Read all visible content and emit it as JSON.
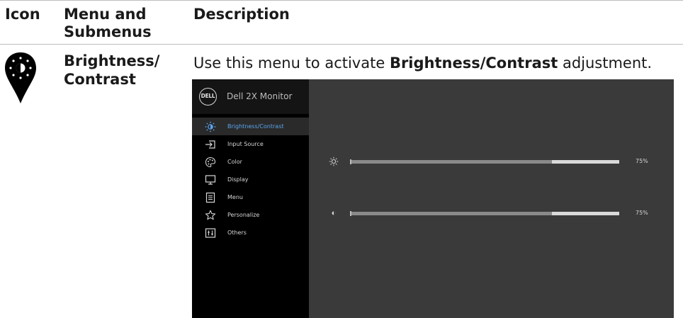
{
  "table": {
    "headers": {
      "icon": "Icon",
      "menu_line1": "Menu and",
      "menu_line2": "Submenus",
      "description": "Description"
    },
    "row": {
      "title_line1": "Brightness/",
      "title_line2": "Contrast",
      "description_prefix": "Use this menu to activate ",
      "description_bold": "Brightness/Contrast",
      "description_suffix": " adjustment.",
      "pin_icon": "brightness-icon"
    }
  },
  "osd": {
    "brand_logo_text": "DELL",
    "brand_name": "Dell 2X Monitor",
    "menu": [
      {
        "label": "Brightness/Contrast",
        "icon": "brightness-icon",
        "active": true
      },
      {
        "label": "Input Source",
        "icon": "input-source-icon",
        "active": false
      },
      {
        "label": "Color",
        "icon": "color-palette-icon",
        "active": false
      },
      {
        "label": "Display",
        "icon": "display-icon",
        "active": false
      },
      {
        "label": "Menu",
        "icon": "menu-list-icon",
        "active": false
      },
      {
        "label": "Personalize",
        "icon": "star-icon",
        "active": false
      },
      {
        "label": "Others",
        "icon": "others-icon",
        "active": false
      }
    ],
    "sliders": [
      {
        "name": "brightness",
        "icon": "sun-icon",
        "value": 75,
        "value_label": "75%"
      },
      {
        "name": "contrast",
        "icon": "contrast-icon",
        "value": 75,
        "value_label": "75%"
      }
    ],
    "colors": {
      "active_text": "#5aa4ee",
      "pin_fill": "#000000",
      "panel_bg": "#3a3a3a",
      "sidebar_bg": "#000000"
    }
  }
}
